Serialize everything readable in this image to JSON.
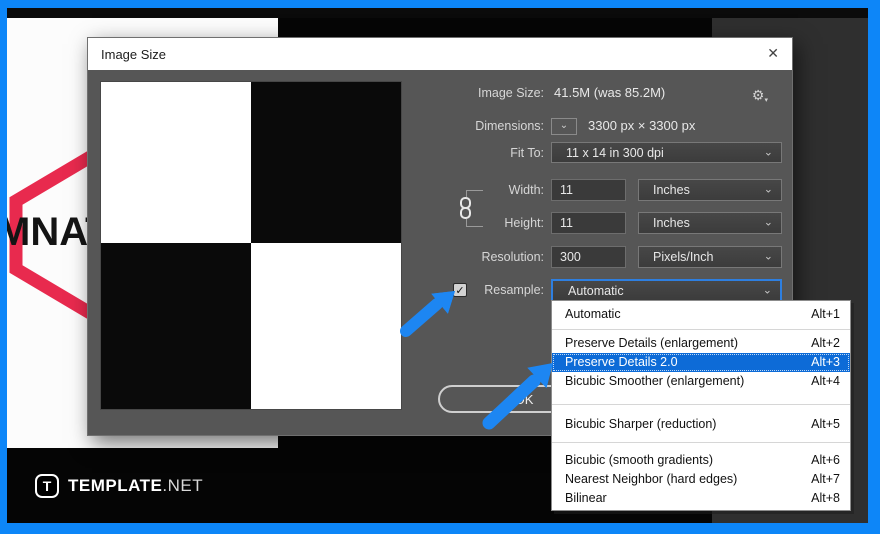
{
  "icons": {
    "close": "✕",
    "chevron": "⌄",
    "gear": "⚙",
    "gear_caret": "▾",
    "check": "✓"
  },
  "colors": {
    "frame_blue": "#0d86f8",
    "arrow_blue": "#1d86f2",
    "selection_blue": "#0d6bd7",
    "focus_border_blue": "#2e7fe0",
    "dialog_gray": "#565656",
    "logo_red": "#e82a4e"
  },
  "dialog": {
    "title": "Image Size",
    "ok_label": "OK",
    "rows": {
      "image_size_label": "Image Size:",
      "image_size_value": "41.5M (was 85.2M)",
      "dimensions_label": "Dimensions:",
      "dimensions_value": "3300 px  ×  3300 px",
      "fit_to_label": "Fit To:",
      "fit_to_value": "11 x 14 in 300 dpi",
      "width_label": "Width:",
      "width_value": "11",
      "width_unit": "Inches",
      "height_label": "Height:",
      "height_value": "11",
      "height_unit": "Inches",
      "resolution_label": "Resolution:",
      "resolution_value": "300",
      "resolution_unit": "Pixels/Inch",
      "resample_label": "Resample:",
      "resample_value": "Automatic",
      "resample_checked": true
    }
  },
  "menu": {
    "groups": [
      {
        "items": [
          {
            "label": "Automatic",
            "shortcut": "Alt+1",
            "selected": false
          }
        ]
      },
      {
        "items": [
          {
            "label": "Preserve Details (enlargement)",
            "shortcut": "Alt+2",
            "selected": false
          },
          {
            "label": "Preserve Details 2.0",
            "shortcut": "Alt+3",
            "selected": true
          },
          {
            "label": "Bicubic Smoother (enlargement)",
            "shortcut": "Alt+4",
            "selected": false
          }
        ]
      },
      {
        "items": [
          {
            "label": "Bicubic Sharper (reduction)",
            "shortcut": "Alt+5",
            "selected": false
          }
        ]
      },
      {
        "items": [
          {
            "label": "Bicubic (smooth gradients)",
            "shortcut": "Alt+6",
            "selected": false
          },
          {
            "label": "Nearest Neighbor (hard edges)",
            "shortcut": "Alt+7",
            "selected": false
          },
          {
            "label": "Bilinear",
            "shortcut": "Alt+8",
            "selected": false
          }
        ]
      }
    ]
  },
  "background": {
    "logo_text": "MNAT",
    "watermark_icon_letter": "T",
    "watermark_brand": "TEMPLATE",
    "watermark_tld": ".NET"
  }
}
